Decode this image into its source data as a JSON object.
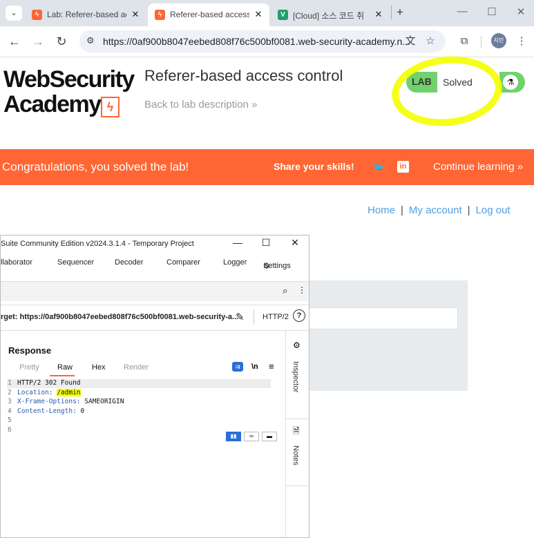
{
  "browser": {
    "tabs": [
      {
        "title": "Lab: Referer-based ac",
        "favicon": "portswigger-bolt-icon",
        "color": "#ff6633",
        "active": false
      },
      {
        "title": "Referer-based access",
        "favicon": "portswigger-bolt-icon",
        "color": "#ff6633",
        "active": true
      },
      {
        "title": "[Cloud] 소스 코드 취",
        "favicon": "v-icon",
        "color": "#1f9e6b",
        "active": false
      }
    ],
    "new_tab": "+",
    "url": "https://0af900b8047eebed808f76c500bf0081.web-security-academy.n...",
    "profile_initials": "지민"
  },
  "page": {
    "logo_line1": "WebSecurity",
    "logo_line2": "Academy",
    "lab_title": "Referer-based access control",
    "back_link": "Back to lab description",
    "back_link_arrow": "»",
    "lab_badge": {
      "label": "LAB",
      "status": "Solved",
      "color": "#70d16d"
    },
    "banner": {
      "message": "Congratulations, you solved the lab!",
      "share": "Share your skills!",
      "continue": "Continue learning",
      "continue_arrow": "»",
      "color": "#ff6633"
    },
    "nav": {
      "home": "Home",
      "account": "My account",
      "logout": "Log out",
      "separator": "|"
    }
  },
  "burp": {
    "title": "Suite Community Edition v2024.3.1.4 - Temporary Project",
    "menu": [
      "llaborator",
      "Sequencer",
      "Decoder",
      "Comparer",
      "Logger",
      "Settings"
    ],
    "target": "rget: https://0af900b8047eebed808f76c500bf0081.web-security-a...",
    "protocol": "HTTP/2",
    "response_title": "Response",
    "response_tabs": [
      "Pretty",
      "Raw",
      "Hex",
      "Render"
    ],
    "newline_toggle": "\\n",
    "side_tabs": [
      "Inspector",
      "Notes"
    ],
    "lines": [
      {
        "n": "1",
        "key": "",
        "sep": "",
        "val": "HTTP/2 302 Found"
      },
      {
        "n": "2",
        "key": "Location",
        "sep": ": ",
        "val": "/admin"
      },
      {
        "n": "3",
        "key": "X-Frame-Options",
        "sep": ": ",
        "val": "SAMEORIGIN"
      },
      {
        "n": "4",
        "key": "Content-Length",
        "sep": ": ",
        "val": "0"
      },
      {
        "n": "5",
        "key": "",
        "sep": "",
        "val": ""
      },
      {
        "n": "6",
        "key": "",
        "sep": "",
        "val": ""
      }
    ]
  }
}
